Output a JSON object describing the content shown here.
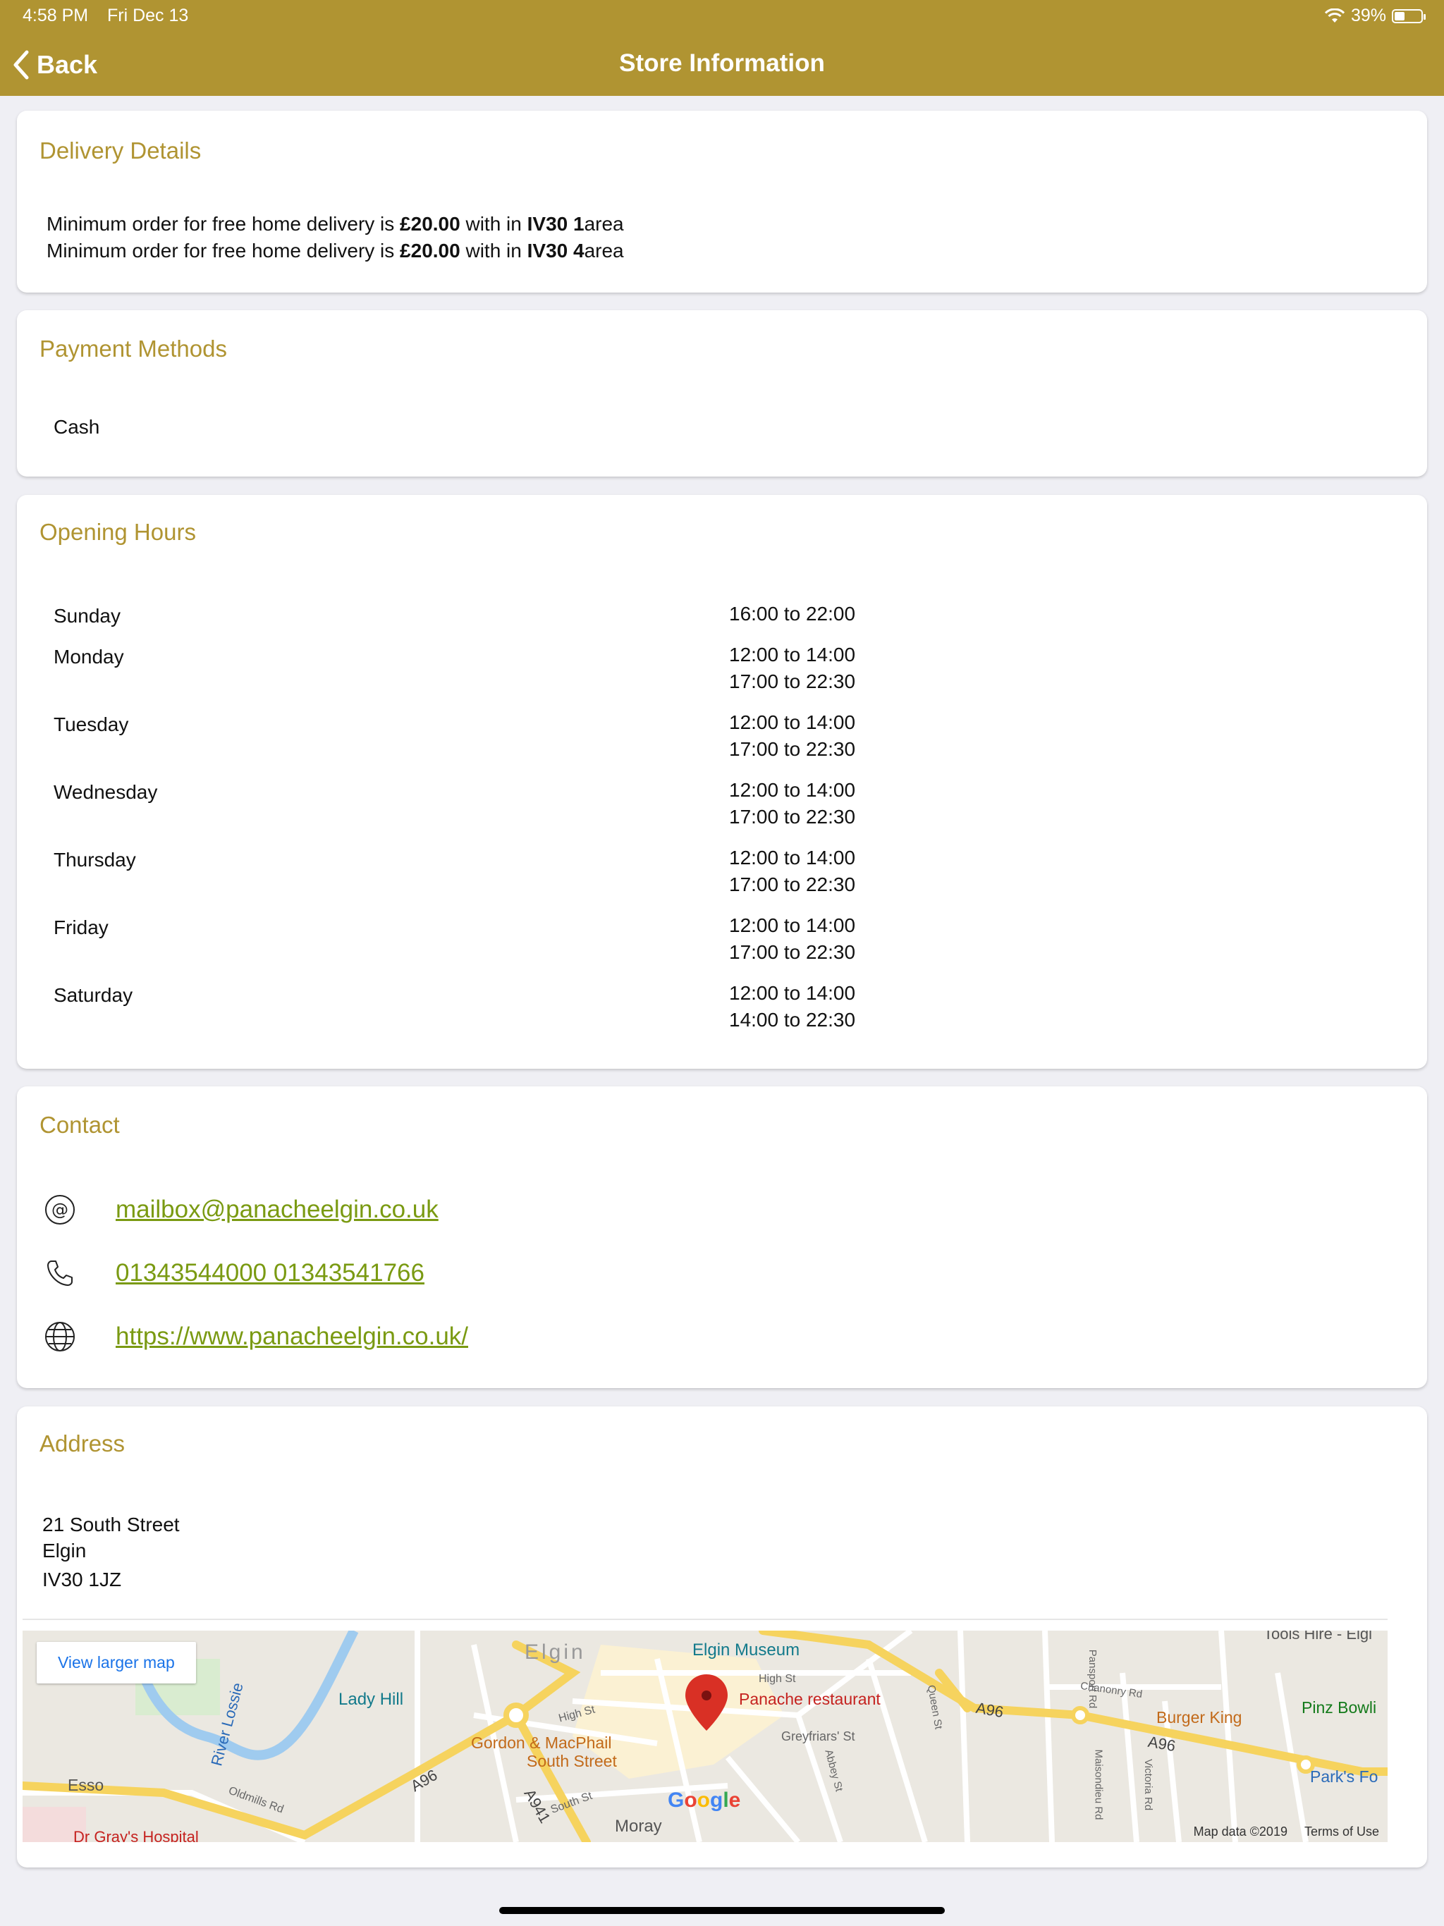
{
  "status": {
    "time": "4:58 PM",
    "date": "Fri Dec 13",
    "battery": "39%",
    "battery_fraction": 0.39
  },
  "nav": {
    "back_label": "Back",
    "title": "Store Information"
  },
  "delivery": {
    "title": "Delivery Details",
    "lines": [
      {
        "prefix": "Minimum order for free home delivery is ",
        "amount": "£20.00",
        "middle": " with in ",
        "area": "IV30 1",
        "suffix": "area"
      },
      {
        "prefix": "Minimum order for free home delivery is ",
        "amount": "£20.00",
        "middle": " with in ",
        "area": "IV30 4",
        "suffix": "area"
      }
    ]
  },
  "payment": {
    "title": "Payment Methods",
    "methods": [
      "Cash"
    ]
  },
  "hours": {
    "title": "Opening Hours",
    "days": [
      {
        "day": "Sunday",
        "times": [
          "16:00 to 22:00"
        ]
      },
      {
        "day": "Monday",
        "times": [
          "12:00 to 14:00",
          "17:00 to 22:30"
        ]
      },
      {
        "day": "Tuesday",
        "times": [
          "12:00 to 14:00",
          "17:00 to 22:30"
        ]
      },
      {
        "day": "Wednesday",
        "times": [
          "12:00 to 14:00",
          "17:00 to 22:30"
        ]
      },
      {
        "day": "Thursday",
        "times": [
          "12:00 to 14:00",
          "17:00 to 22:30"
        ]
      },
      {
        "day": "Friday",
        "times": [
          "12:00 to 14:00",
          "17:00 to 22:30"
        ]
      },
      {
        "day": "Saturday",
        "times": [
          "12:00 to 14:00",
          "14:00 to 22:30"
        ]
      }
    ]
  },
  "contact": {
    "title": "Contact",
    "email": "mailbox@panacheelgin.co.uk",
    "phone": "01343544000 01343541766",
    "website": "https://www.panacheelgin.co.uk/",
    "icons": [
      "at-icon",
      "phone-icon",
      "globe-icon"
    ],
    "link_color": "#7a9a12"
  },
  "address": {
    "title": "Address",
    "line1": "21 South Street",
    "line2": "Elgin",
    "line3": "IV30 1JZ"
  },
  "map": {
    "view_larger": "View larger map",
    "marker_label": "Panache restaurant",
    "map_data": "Map data ©2019",
    "terms": "Terms of Use",
    "google": "Google",
    "labels": {
      "elgin": "Elgin",
      "museum": "Elgin Museum",
      "lady_hill": "Lady Hill",
      "river": "River Lossie",
      "gordon1": "Gordon & MacPhail",
      "gordon2": "South Street",
      "burger": "Burger King",
      "pinz": "Pinz Bowli",
      "parks": "Park's Fo",
      "esso": "Esso",
      "hospital": "Dr Gray's Hospital",
      "moray": "Moray",
      "high_st": "High St",
      "high_st2": "High St",
      "greyfriars": "Greyfriars' St",
      "a96a": "A96",
      "a96b": "A96",
      "a96c": "A96",
      "a941": "A941",
      "south_st": "South St",
      "oldmills": "Oldmills Rd",
      "abbey": "Abbey St",
      "queen": "Queen St",
      "pansport": "Pansport Rd",
      "maisondieu": "Maisondieu Rd",
      "chanonry": "Chanonry Rd",
      "victoria": "Victoria Rd",
      "tools": "Tools Hire - Elgi"
    },
    "colors": {
      "road_major": "#f6d35e",
      "road_minor": "#ffffff",
      "water": "#9fcbef",
      "marker": "#d93025",
      "label_text": "#c5221f"
    }
  },
  "theme": {
    "brand": "#b09432",
    "background": "#efeff4"
  }
}
